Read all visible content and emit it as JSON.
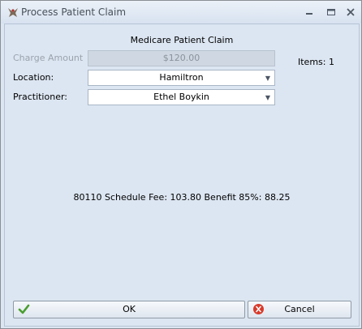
{
  "window": {
    "title": "Process Patient Claim"
  },
  "form": {
    "heading": "Medicare Patient Claim",
    "charge_amount_label": "Charge Amount",
    "charge_amount_value": "$120.00",
    "location_label": "Location:",
    "location_value": "Hamiltron",
    "practitioner_label": "Practitioner:",
    "practitioner_value": "Ethel Boykin",
    "items_text": "Items: 1",
    "summary_text": "80110 Schedule Fee: 103.80 Benefit 85%: 88.25"
  },
  "buttons": {
    "ok_label": "OK",
    "cancel_label": "Cancel"
  },
  "icons": {
    "app": "bird-icon",
    "minimize": "minimize-icon",
    "maximize": "maximize-icon",
    "close": "close-icon",
    "ok": "checkmark-icon",
    "cancel": "cancel-icon",
    "dropdown": "chevron-down-icon"
  }
}
